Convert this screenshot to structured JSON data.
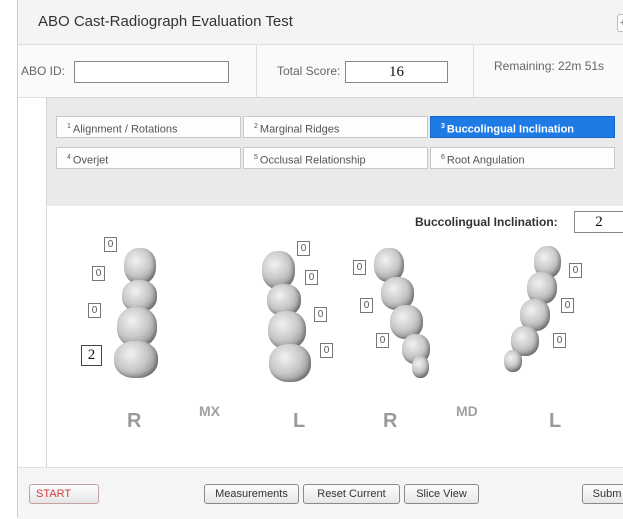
{
  "window": {
    "title": "ABO Cast-Radiograph Evaluation Test",
    "corner_button": "+"
  },
  "info": {
    "abo_id_label": "ABO ID:",
    "abo_id_value": "",
    "total_score_label": "Total Score:",
    "total_score_value": "16",
    "remaining": "Remaining: 22m 51s"
  },
  "tabs": [
    {
      "num": "1",
      "label": "Alignment / Rotations",
      "active": false
    },
    {
      "num": "2",
      "label": "Marginal Ridges",
      "active": false
    },
    {
      "num": "3",
      "label": "Buccolingual Inclination",
      "active": true
    },
    {
      "num": "4",
      "label": "Overjet",
      "active": false
    },
    {
      "num": "5",
      "label": "Occlusal Relationship",
      "active": false
    },
    {
      "num": "6",
      "label": "Root Angulation",
      "active": false
    }
  ],
  "criterion": {
    "label": "Buccolingual Inclination:",
    "value": "2"
  },
  "arches": {
    "mx_r_scores": [
      "0",
      "0",
      "0",
      "2"
    ],
    "mx_l_scores": [
      "0",
      "0",
      "0",
      "0"
    ],
    "md_r_scores": [
      "0",
      "0",
      "0"
    ],
    "md_l_scores": [
      "0",
      "0",
      "0"
    ]
  },
  "letters": {
    "mx_r": "R",
    "mx": "MX",
    "mx_l": "L",
    "md_r": "R",
    "md": "MD",
    "md_l": "L"
  },
  "footer": {
    "start": "START",
    "measurements": "Measurements",
    "reset_current": "Reset Current",
    "slice_view": "Slice View",
    "submit": "Subm"
  },
  "colors": {
    "active_tab": "#1e7be6",
    "start_text": "#d23b3b"
  }
}
